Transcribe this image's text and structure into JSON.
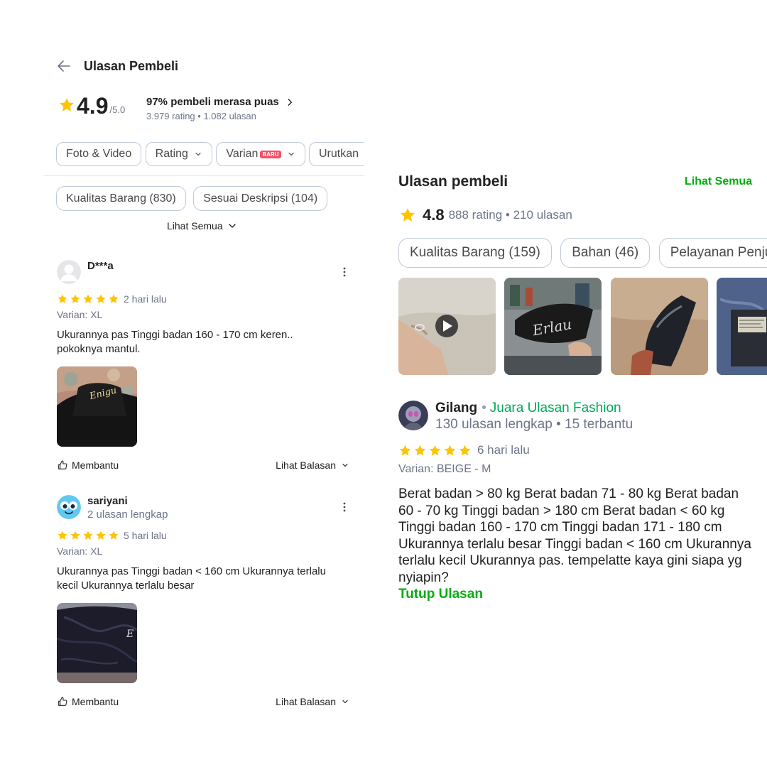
{
  "left_panel": {
    "header": {
      "title": "Ulasan Pembeli",
      "back_icon": "arrow-left-icon"
    },
    "summary": {
      "score": "4.9",
      "scale": "/5.0",
      "satisfaction": "97% pembeli merasa puas",
      "counts": "3.979 rating • 1.082 ulasan"
    },
    "filters": [
      {
        "label": "Foto & Video"
      },
      {
        "label": "Rating"
      },
      {
        "label": "Varian",
        "badge": "BARU"
      },
      {
        "label": "Urutkan"
      }
    ],
    "topic_tags": [
      {
        "label": "Kualitas Barang (830)"
      },
      {
        "label": "Sesuai Deskripsi (104)"
      }
    ],
    "see_all": "Lihat Semua",
    "reviews": [
      {
        "name": "D***a",
        "subtitle": "",
        "rating": 5,
        "time": "2 hari lalu",
        "variant": "Varian: XL",
        "text": "Ukurannya pas Tinggi badan 160 - 170 cm keren.. pokoknya mantul.",
        "helpful": "Membantu",
        "replies": "Lihat Balasan"
      },
      {
        "name": "sariyani",
        "subtitle": "2 ulasan lengkap",
        "rating": 5,
        "time": "5 hari lalu",
        "variant": "Varian: XL",
        "text": "Ukurannya pas Tinggi badan < 160 cm Ukurannya terlalu kecil Ukurannya terlalu besar",
        "helpful": "Membantu",
        "replies": "Lihat Balasan"
      }
    ]
  },
  "right_panel": {
    "title": "Ulasan pembeli",
    "see_all": "Lihat Semua",
    "summary": {
      "score": "4.8",
      "counts": "888 rating • 210 ulasan"
    },
    "topic_tags": [
      {
        "label": "Kualitas Barang (159)"
      },
      {
        "label": "Bahan (46)"
      },
      {
        "label": "Pelayanan Penjual"
      }
    ],
    "review": {
      "name": "Gilang",
      "badge": "Juara Ulasan Fashion",
      "stats": "130 ulasan lengkap • 15 terbantu",
      "rating": 5,
      "time": "6 hari lalu",
      "variant": "Varian: BEIGE - M",
      "text": "Berat badan > 80 kg Berat badan 71 - 80 kg Berat badan 60 - 70 kg Tinggi badan > 180 cm Berat badan < 60 kg Tinggi badan 160 - 170 cm Tinggi badan 171 - 180 cm Ukurannya terlalu besar Tinggi badan < 160 cm Ukurannya terlalu kecil Ukurannya pas. tempelatte kaya gini siapa yg nyiapin?",
      "collapse": "Tutup Ulasan"
    }
  },
  "colors": {
    "accent_green": "#03ac0e",
    "star": "#ffc400",
    "badge_red": "#f94d63",
    "muted": "#6d7588"
  }
}
